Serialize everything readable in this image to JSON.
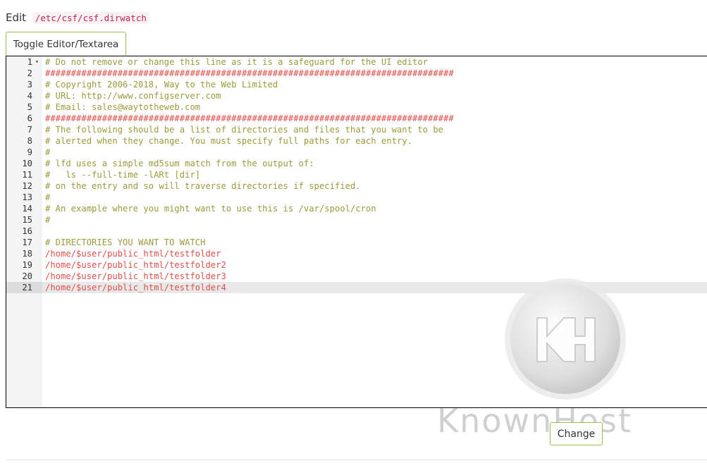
{
  "header": {
    "edit_label": "Edit",
    "file_path": "/etc/csf/csf.dirwatch"
  },
  "toolbar": {
    "toggle_label": "Toggle Editor/Textarea"
  },
  "editor": {
    "active_line": 21,
    "lines": [
      {
        "n": "1",
        "text": "# Do not remove or change this line as it is a safeguard for the UI editor",
        "style": "comment",
        "fold": true
      },
      {
        "n": "2",
        "text": "###############################################################################",
        "style": "hash"
      },
      {
        "n": "3",
        "text": "# Copyright 2006-2018, Way to the Web Limited",
        "style": "comment"
      },
      {
        "n": "4",
        "text": "# URL: http://www.configserver.com",
        "style": "comment"
      },
      {
        "n": "5",
        "text": "# Email: sales@waytotheweb.com",
        "style": "comment"
      },
      {
        "n": "6",
        "text": "###############################################################################",
        "style": "hash"
      },
      {
        "n": "7",
        "text": "# The following should be a list of directories and files that you want to be",
        "style": "comment"
      },
      {
        "n": "8",
        "text": "# alerted when they change. You must specify full paths for each entry.",
        "style": "comment"
      },
      {
        "n": "9",
        "text": "#",
        "style": "comment"
      },
      {
        "n": "10",
        "text": "# lfd uses a simple md5sum match from the output of:",
        "style": "comment"
      },
      {
        "n": "11",
        "text": "#   ls --full-time -lARt [dir]",
        "style": "comment"
      },
      {
        "n": "12",
        "text": "# on the entry and so will traverse directories if specified.",
        "style": "comment"
      },
      {
        "n": "13",
        "text": "#",
        "style": "comment"
      },
      {
        "n": "14",
        "text": "# An example where you might want to use this is /var/spool/cron",
        "style": "comment"
      },
      {
        "n": "15",
        "text": "#",
        "style": "comment"
      },
      {
        "n": "16",
        "text": "",
        "style": "plain"
      },
      {
        "n": "17",
        "text": "# DIRECTORIES YOU WANT TO WATCH",
        "style": "comment"
      },
      {
        "n": "18",
        "text": "/home/$user/public_html/testfolder",
        "style": "path"
      },
      {
        "n": "19",
        "text": "/home/$user/public_html/testfolder2",
        "style": "path"
      },
      {
        "n": "20",
        "text": "/home/$user/public_html/testfolder3",
        "style": "path"
      },
      {
        "n": "21",
        "text": "/home/$user/public_html/testfolder4",
        "style": "path"
      }
    ]
  },
  "footer": {
    "change_label": "Change"
  },
  "watermark": {
    "text": "KnownHost",
    "icon": "knownhost-logo"
  },
  "colors": {
    "comment": "#9b9b3c",
    "path": "#e0504b",
    "button_border": "#9bbf4a"
  }
}
